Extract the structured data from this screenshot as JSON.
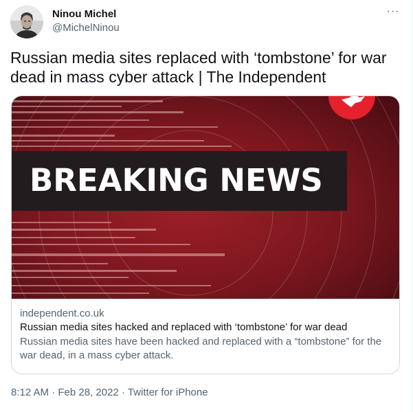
{
  "author": {
    "display_name": "Ninou Michel",
    "handle": "@MichelNinou",
    "avatar_icon": "profile-photo"
  },
  "more_label": "···",
  "tweet": {
    "text": "Russian media sites replaced with ‘tombstone’ for war dead in mass cyber attack | The Independent"
  },
  "card": {
    "image_headline": "BREAKING NEWS",
    "logo_icon": "independent-eagle-logo",
    "domain": "independent.co.uk",
    "title": "Russian media sites hacked and replaced with ‘tombstone’ for war dead",
    "description": "Russian media sites have been hacked and replaced with a “tombstone” for the war dead, in a mass cyber attack.",
    "colors": {
      "bg_dark": "#5a1017",
      "bg_mid": "#8c1a22",
      "banner": "#231c1e",
      "headline": "#ffffff",
      "logo": "#e5222b"
    }
  },
  "footer": {
    "time": "8:12 AM",
    "separator": " · ",
    "date": "Feb 28, 2022",
    "source": "Twitter for iPhone"
  }
}
